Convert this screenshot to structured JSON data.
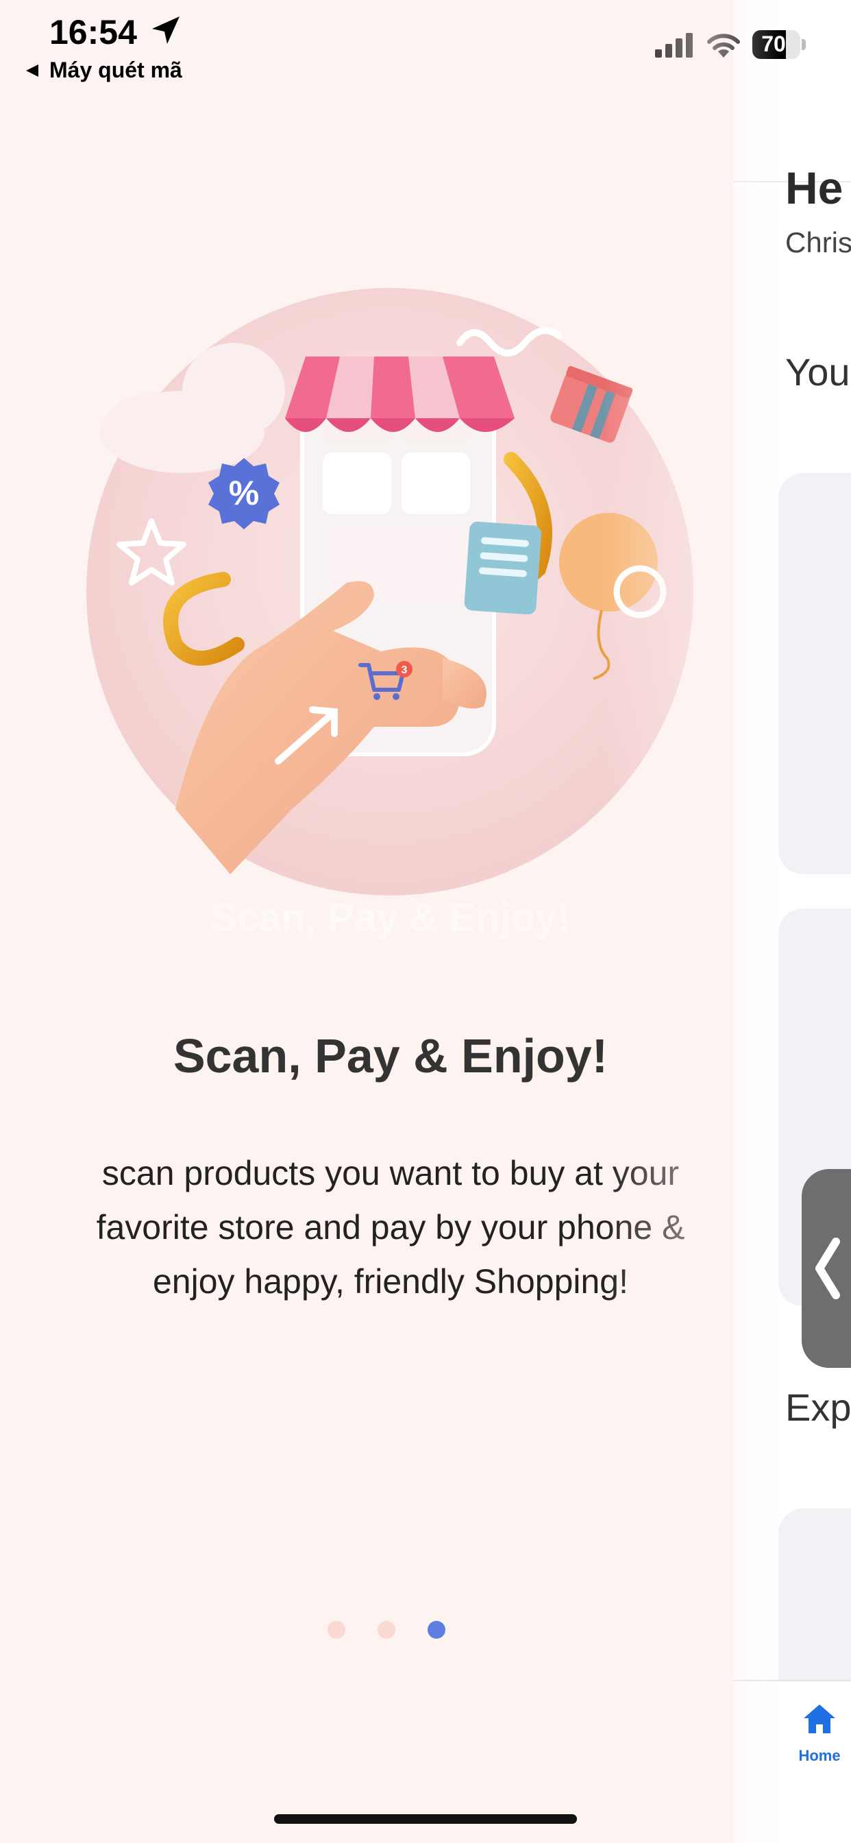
{
  "status_bar": {
    "time": "16:54",
    "back_app": "Máy quét mã",
    "battery": "70",
    "battery_level": 0.7
  },
  "onboarding": {
    "ghost_title": "Scan, Pay & Enjoy!",
    "title": "Scan, Pay & Enjoy!",
    "description": "scan products you want to buy at your favorite store and pay by your phone & enjoy happy, friendly Shopping!",
    "pager": {
      "count": 3,
      "active_index": 2
    },
    "illustration": {
      "badge": "%",
      "cart_count": "3"
    }
  },
  "background_app": {
    "greeting": "He",
    "name": "Chris",
    "section_1": "You",
    "section_2": "Exp",
    "tabbar": {
      "home_label": "Home"
    }
  },
  "colors": {
    "sheet_bg": "#fdf3f1",
    "accent_dot": "#5f7fe0",
    "inactive_dot": "#fad9d3",
    "tab_active": "#1f6fe5"
  }
}
